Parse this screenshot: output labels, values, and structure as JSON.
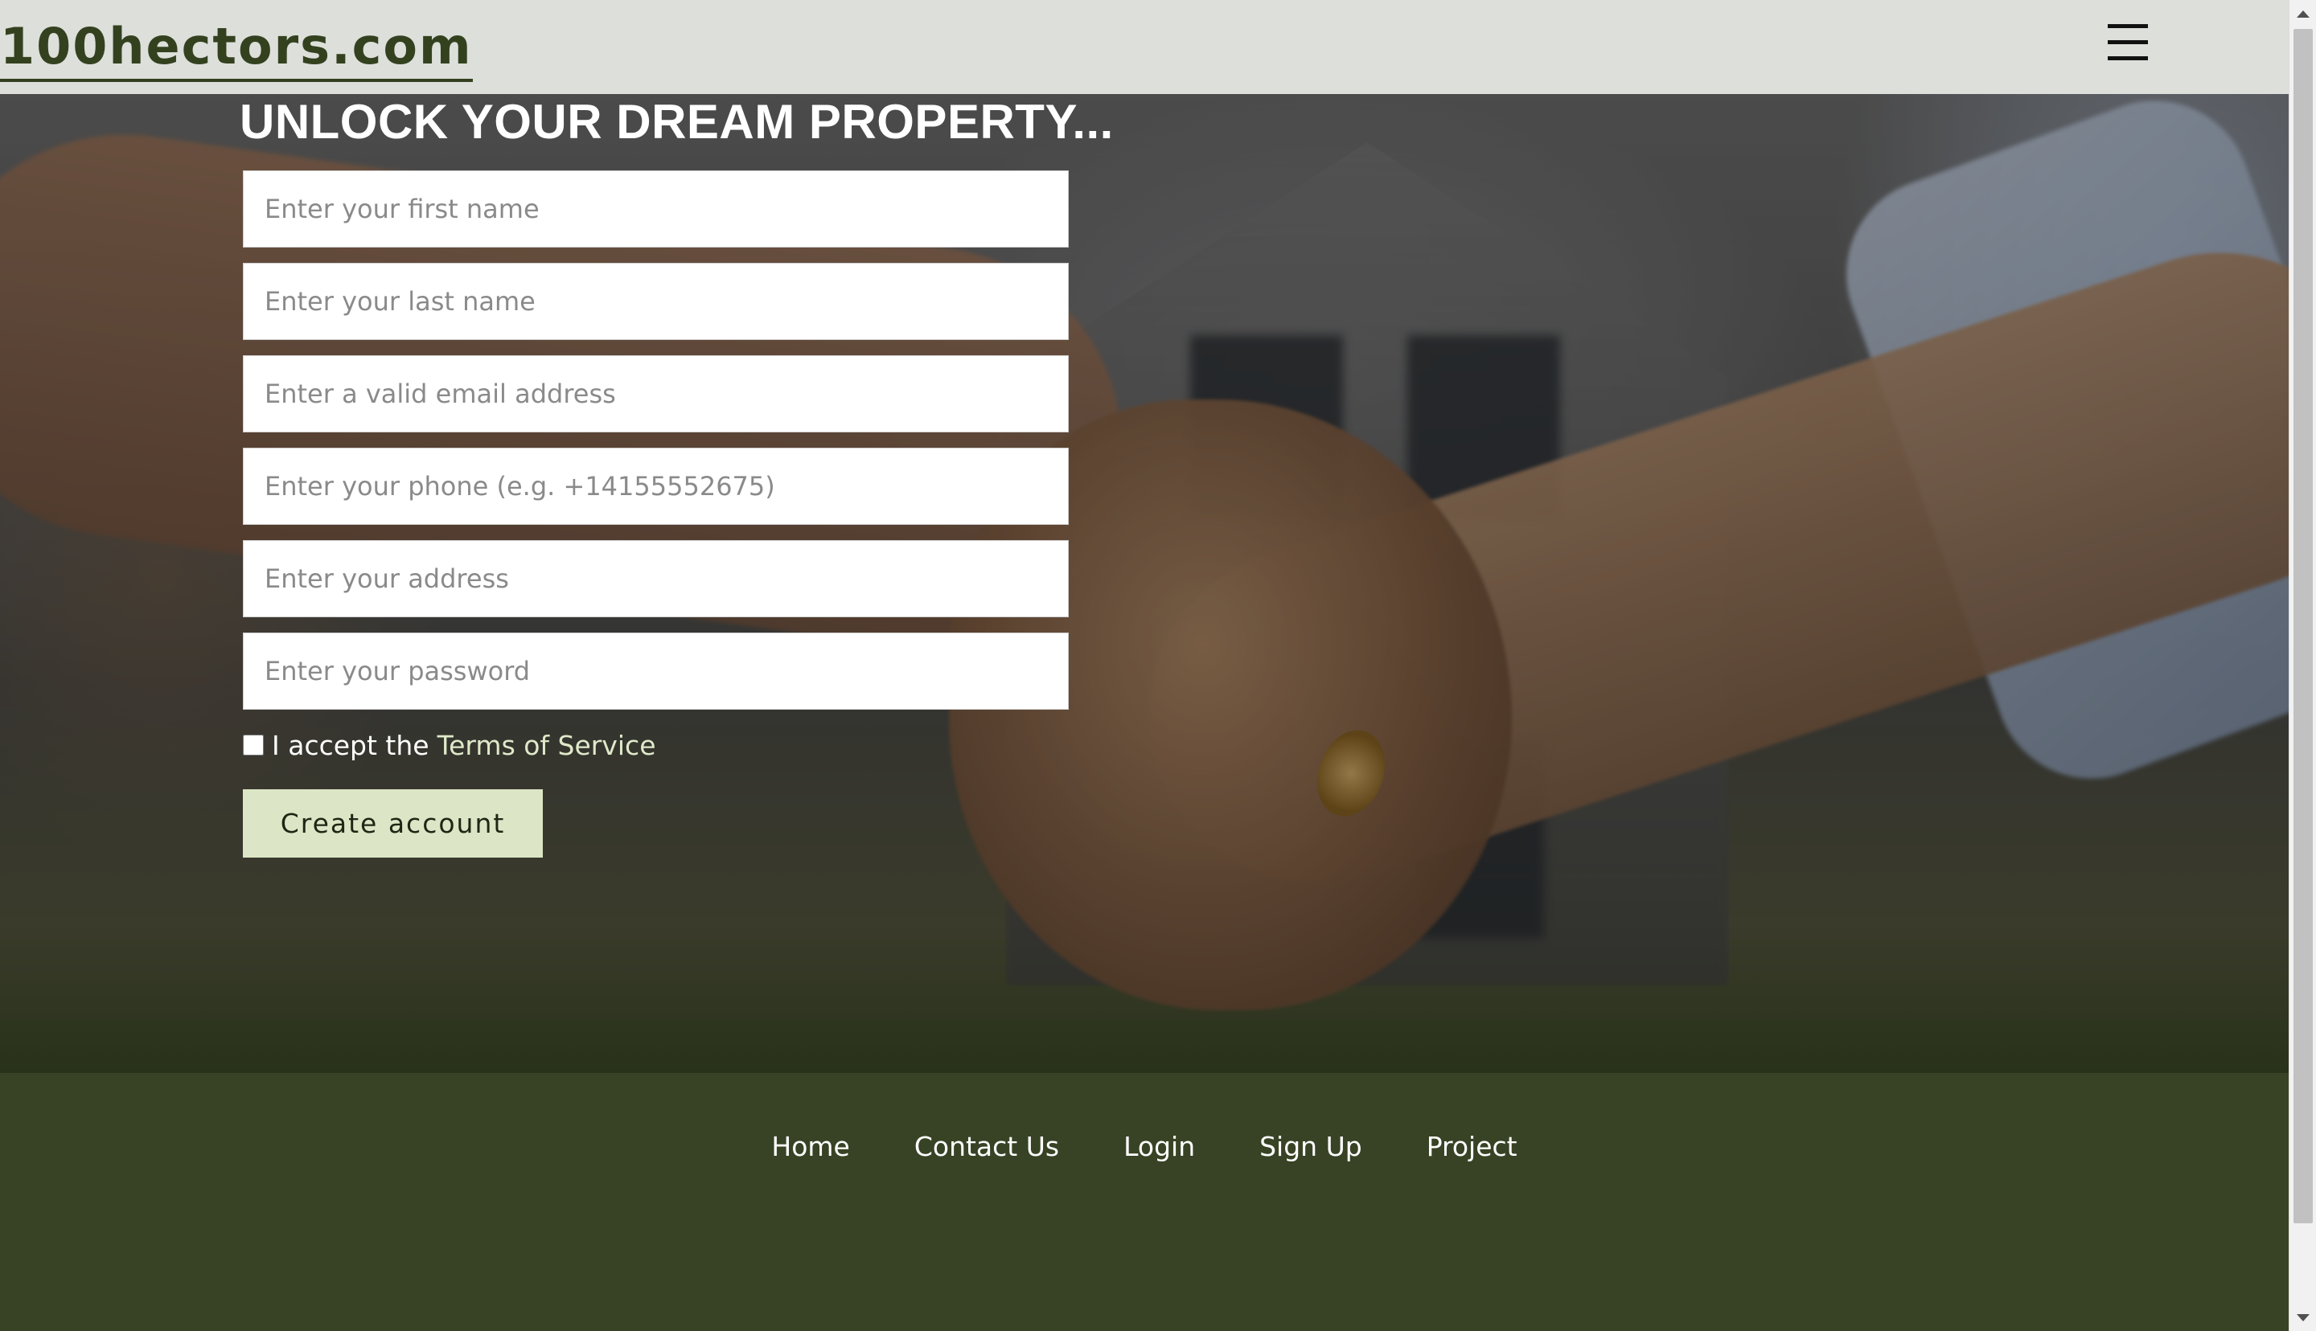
{
  "header": {
    "brand": "100hectors.com",
    "menu_icon": "hamburger-menu-icon"
  },
  "hero": {
    "title": "UNLOCK YOUR DREAM PROPERTY...",
    "background": "handshake-in-front-of-house-photo"
  },
  "form": {
    "first_name_placeholder": "Enter your first name",
    "last_name_placeholder": "Enter your last name",
    "email_placeholder": "Enter a valid email address",
    "phone_placeholder": "Enter your phone (e.g. +14155552675)",
    "address_placeholder": "Enter your address",
    "password_placeholder": "Enter your password",
    "terms_prefix": "I accept the",
    "terms_link": "Terms of Service",
    "terms_checked": false,
    "submit_label": "Create account"
  },
  "footer": {
    "links": [
      "Home",
      "Contact Us",
      "Login",
      "Sign Up",
      "Project"
    ]
  },
  "colors": {
    "header_bg": "#dcdfda",
    "brand": "#34411f",
    "button_bg": "#dce6c6",
    "footer_bg": "#384325",
    "link_accent": "#dfe9c9"
  }
}
